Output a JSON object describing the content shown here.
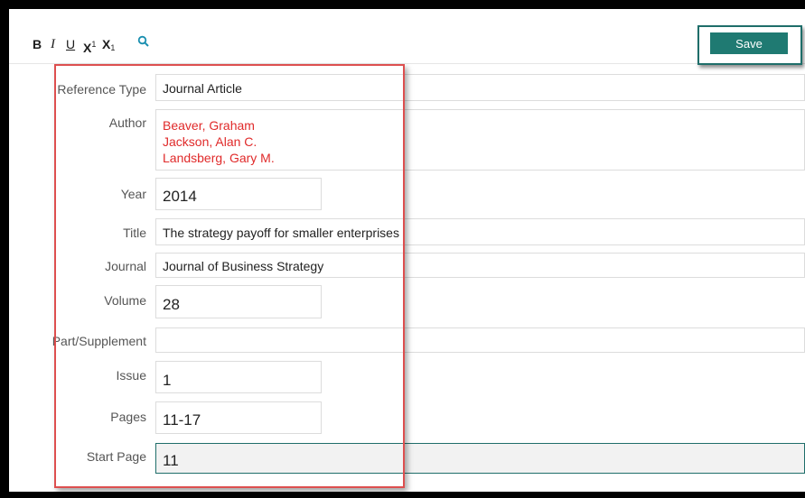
{
  "toolbar": {
    "bold": "B",
    "italic": "I",
    "underline": "U",
    "superscript": "X",
    "superscript_small": "1",
    "subscript": "X",
    "subscript_small": "1",
    "search_icon": "search-icon",
    "save_label": "Save",
    "accent_color": "#1f7a72"
  },
  "form": {
    "reference_type": {
      "label": "Reference Type",
      "value": "Journal Article"
    },
    "author": {
      "label": "Author",
      "values": [
        "Beaver, Graham",
        "Jackson, Alan C.",
        "Landsberg, Gary M."
      ],
      "color": "#e02a2a"
    },
    "year": {
      "label": "Year",
      "value": "2014"
    },
    "title": {
      "label": "Title",
      "value": "The strategy payoff for smaller enterprises"
    },
    "journal": {
      "label": "Journal",
      "value": "Journal of Business Strategy"
    },
    "volume": {
      "label": "Volume",
      "value": "28"
    },
    "part_supplement": {
      "label": "Part/Supplement",
      "value": ""
    },
    "issue": {
      "label": "Issue",
      "value": "1"
    },
    "pages": {
      "label": "Pages",
      "value": "11-17"
    },
    "start_page": {
      "label": "Start Page",
      "value": "11"
    }
  },
  "highlight_color": "#dd4f4f"
}
